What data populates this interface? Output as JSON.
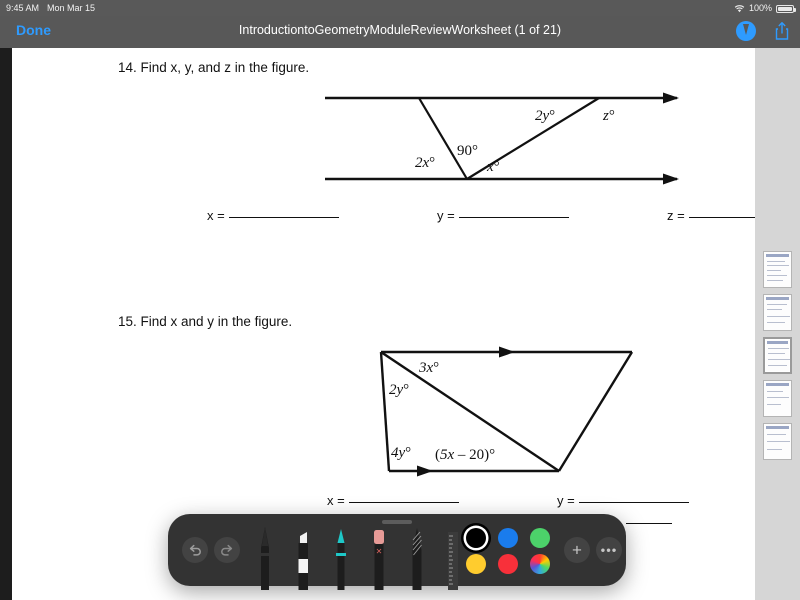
{
  "status_bar": {
    "time": "9:45 AM",
    "date": "Mon Mar 15",
    "battery_percent": "100%",
    "wifi_icon": "wifi-icon",
    "battery_icon": "battery-icon"
  },
  "nav_bar": {
    "done_label": "Done",
    "title": "IntroductiontoGeometryModuleReviewWorksheet (1 of 21)",
    "markup_icon": "markup-pen-icon",
    "share_icon": "share-icon",
    "accent_color": "#2e9bff",
    "background_color": "#585858"
  },
  "document": {
    "questions": [
      {
        "id": "q14",
        "text": "14. Find x, y, and z in the figure.",
        "figure": {
          "type": "two-parallel-lines-transversals",
          "labels": [
            "2y°",
            "z°",
            "90°",
            "2x°",
            "x°"
          ]
        },
        "answers": [
          {
            "label": "x =",
            "value": ""
          },
          {
            "label": "y =",
            "value": ""
          },
          {
            "label": "z =",
            "value": ""
          }
        ]
      },
      {
        "id": "q15",
        "text": "15. Find x and y in the figure.",
        "figure": {
          "type": "trapezoid-with-diagonal",
          "labels": [
            "3x°",
            "2y°",
            "4y°",
            "(5x – 20)°"
          ]
        },
        "answers": [
          {
            "label": "x =",
            "value": ""
          },
          {
            "label": "y =",
            "value": ""
          }
        ]
      }
    ]
  },
  "thumbnail_sidebar": {
    "name": "page-thumbnails",
    "selected_index": 2,
    "count": 5
  },
  "markup_toolbar": {
    "undo_icon": "undo-arrow-icon",
    "redo_icon": "redo-arrow-icon",
    "add_icon": "plus-icon",
    "more_icon": "ellipsis-icon",
    "background_color": "#333333",
    "tools": [
      {
        "name": "pen-tool",
        "label": "Pen",
        "selected": false
      },
      {
        "name": "highlighter-tool",
        "label": "Highlighter",
        "selected": false
      },
      {
        "name": "marker-tool",
        "label": "Marker",
        "selected": false
      },
      {
        "name": "eraser-tool",
        "label": "Eraser",
        "selected": false
      },
      {
        "name": "lasso-tool",
        "label": "Lasso",
        "selected": false
      },
      {
        "name": "ruler-tool",
        "label": "Ruler",
        "selected": false
      }
    ],
    "colors": [
      {
        "name": "black",
        "hex": "#000000",
        "selected": true
      },
      {
        "name": "blue",
        "hex": "#1a7ced",
        "selected": false
      },
      {
        "name": "green",
        "hex": "#4cd26a",
        "selected": false
      },
      {
        "name": "yellow",
        "hex": "#ffcc2e",
        "selected": false
      },
      {
        "name": "red",
        "hex": "#f8303a",
        "selected": false
      },
      {
        "name": "color-picker",
        "hex": "rainbow",
        "selected": false
      }
    ]
  }
}
